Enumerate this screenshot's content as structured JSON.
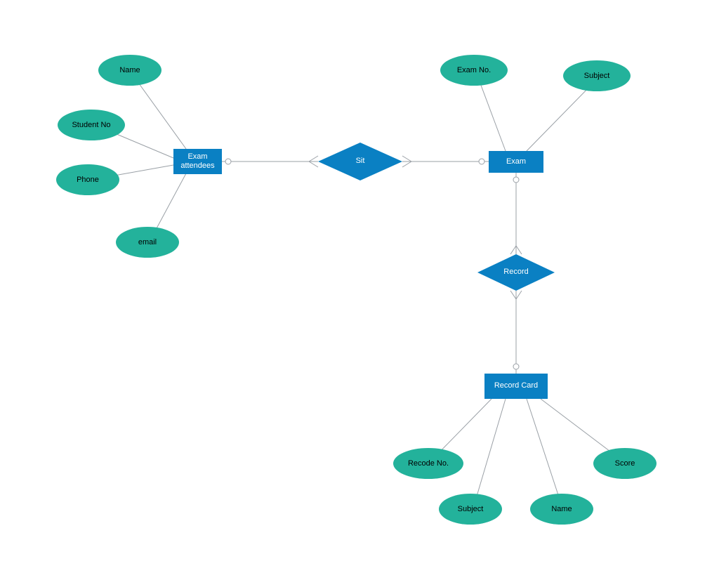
{
  "entities": {
    "examAttendees": "Exam attendees",
    "exam": "Exam",
    "recordCard": "Record Card"
  },
  "relationships": {
    "sit": "Sit",
    "record": "Record"
  },
  "attributes": {
    "name": "Name",
    "studentNo": "Student No",
    "phone": "Phone",
    "email": "email",
    "examNo": "Exam No.",
    "subject": "Subject",
    "recodeNo": "Recode No.",
    "rcSubject": "Subject",
    "rcName": "Name",
    "score": "Score"
  },
  "colors": {
    "entity": "#0a80c3",
    "attribute": "#23b29b",
    "line": "#999999"
  }
}
